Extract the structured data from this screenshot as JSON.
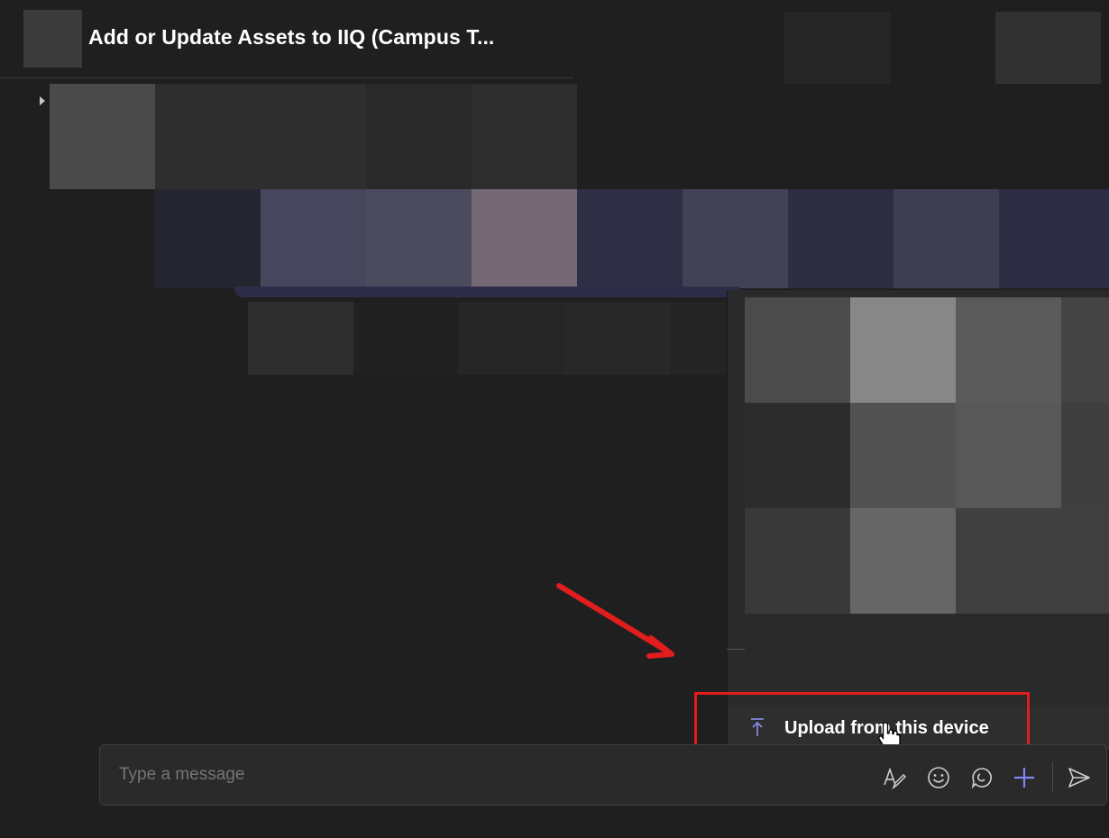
{
  "header": {
    "title": "Add or Update Assets to IIQ (Campus T..."
  },
  "attach_menu": {
    "upload_label": "Upload from this device",
    "upload_icon": "upload-icon"
  },
  "composer": {
    "placeholder": "Type a message",
    "tools": [
      "format-icon",
      "emoji-icon",
      "sticker-icon",
      "attach-plus-icon",
      "send-icon"
    ],
    "accent_color": "#7f85f5"
  },
  "annotation": {
    "highlight_color": "#e11d1d"
  }
}
